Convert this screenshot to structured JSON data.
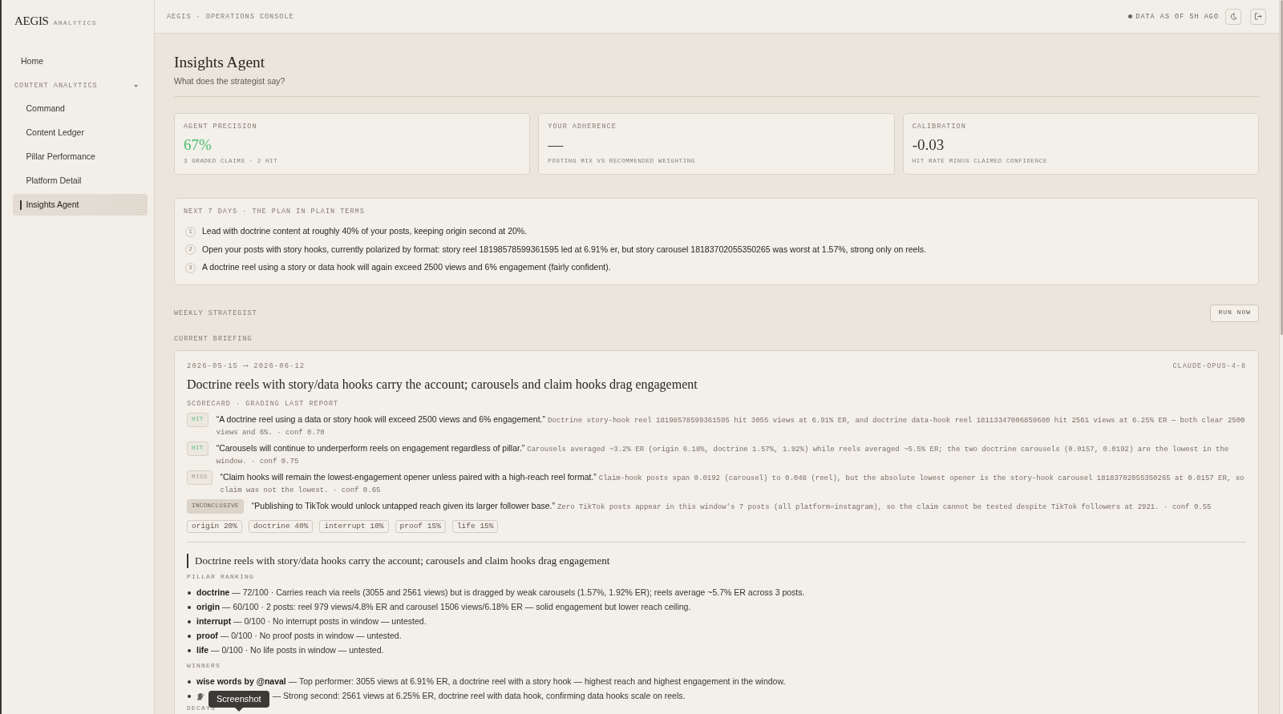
{
  "sidebar": {
    "brand": {
      "name": "AEGIS",
      "suffix": "ANALYTICS"
    },
    "items": [
      {
        "kind": "link",
        "label": "Home",
        "selected": false
      },
      {
        "kind": "section",
        "label": "CONTENT ANALYTICS",
        "expanded": true,
        "children": [
          {
            "label": "Command",
            "selected": false
          },
          {
            "label": "Content Ledger",
            "selected": false
          },
          {
            "label": "Pillar Performance",
            "selected": false
          },
          {
            "label": "Platform Detail",
            "selected": false
          },
          {
            "label": "Insights Agent",
            "selected": true
          }
        ]
      }
    ]
  },
  "topbar": {
    "breadcrumb": "AEGIS · OPERATIONS CONSOLE",
    "status": "DATA AS OF 5H AGO"
  },
  "page": {
    "title": "Insights Agent",
    "subtitle": "What does the strategist say?"
  },
  "kpis": [
    {
      "label": "AGENT PRECISION",
      "value": "67%",
      "note": "3 GRADED CLAIMS · 2 HIT",
      "color": "#45bf6b"
    },
    {
      "label": "YOUR ADHERENCE",
      "value": "—",
      "note": "POSTING MIX VS RECOMMENDED WEIGHTING",
      "color": "#3a342f"
    },
    {
      "label": "CALIBRATION",
      "value": "-0.03",
      "note": "HIT RATE MINUS CLAIMED CONFIDENCE",
      "color": "#3a342f"
    }
  ],
  "plan": {
    "heading": "NEXT 7 DAYS · THE PLAN IN PLAIN TERMS",
    "steps": [
      {
        "number": "1",
        "text": "Lead with doctrine content at roughly 40% of your posts, keeping origin second at 20%."
      },
      {
        "number": "2",
        "text": "Open your posts with story hooks, currently polarized by format: story reel 18198578599361595 led at 6.91% er, but story carousel 18183702055350265 was worst at 1.57%, strong only on reels."
      },
      {
        "number": "3",
        "text": "A doctrine reel using a story or data hook will again exceed 2500 views and 6% engagement (fairly confident)."
      }
    ]
  },
  "strategist": {
    "heading": "WEEKLY STRATEGIST",
    "run_button": "RUN NOW",
    "briefing_label": "CURRENT BRIEFING"
  },
  "briefing": {
    "range": "2026-05-15 ⟶ 2026-06-12",
    "model": "CLAUDE-OPUS-4-8",
    "title": "Doctrine reels with story/data hooks carry the account; carousels and claim hooks drag engagement",
    "scorecard_heading": "SCORECARD · GRADING LAST REPORT",
    "claims": [
      {
        "verdict": "HIT",
        "kind": "hit",
        "claim": "“A doctrine reel using a data or story hook will exceed 2500 views and 6% engagement.”",
        "evidence": "Doctrine story-hook reel 18198578599361595 hit 3055 views at 6.91% ER, and doctrine data-hook reel 18113347006859680 hit 2561 views at 6.25% ER — both clear 2500 views and 6%. · conf 0.70"
      },
      {
        "verdict": "HIT",
        "kind": "hit",
        "claim": "“Carousels will continue to underperform reels on engagement regardless of pillar.”",
        "evidence": "Carousels averaged ~3.2% ER (origin 6.18%, doctrine 1.57%, 1.92%) while reels averaged ~5.5% ER; the two doctrine carousels (0.0157, 0.0192) are the lowest in the window. · conf 0.75"
      },
      {
        "verdict": "MISS",
        "kind": "miss",
        "claim": "“Claim hooks will remain the lowest-engagement opener unless paired with a high-reach reel format.”",
        "evidence": "Claim-hook posts span 0.0192 (carousel) to 0.048 (reel), but the absolute lowest opener is the story-hook carousel 18183702055350265 at 0.0157 ER, so claim was not the lowest. · conf 0.65"
      },
      {
        "verdict": "INCONCLUSIVE",
        "kind": "inconclusive",
        "claim": "“Publishing to TikTok would unlock untapped reach given its larger follower base.”",
        "evidence": "Zero TikTok posts appear in this window's 7 posts (all platform=instagram), so the claim cannot be tested despite TikTok followers at 2921. · conf 0.55"
      }
    ],
    "weights": [
      "origin 20%",
      "doctrine 40%",
      "interrupt 10%",
      "proof 15%",
      "life 15%"
    ],
    "report": {
      "heading": "Doctrine reels with story/data hooks carry the account; carousels and claim hooks drag engagement",
      "sections": [
        {
          "heading": "PILLAR RANKING",
          "items": [
            {
              "text": "**doctrine** — 72/100 · Carries reach via reels (3055 and 2561 views) but is dragged by weak carousels (1.57%, 1.92% ER); reels average ~5.7% ER across 3 posts."
            },
            {
              "text": "**origin** — 60/100 · 2 posts: reel 979 views/4.8% ER and carousel 1506 views/6.18% ER — solid engagement but lower reach ceiling."
            },
            {
              "text": "**interrupt** — 0/100 · No interrupt posts in window — untested."
            },
            {
              "text": "**proof** — 0/100 · No proof posts in window — untested."
            },
            {
              "text": "**life** — 0/100 · No life posts in window — untested."
            }
          ]
        },
        {
          "heading": "WINNERS",
          "items": [
            {
              "text": "**wise words by @naval** — Top performer: 3055 views at 6.91% ER, a doctrine reel with a story hook — highest reach and highest engagement in the window.",
              "lead_icon": false
            },
            {
              "text": "— Strong second: 2561 views at 6.25% ER, doctrine reel with data hook, confirming data hooks scale on reels.",
              "lead_icon": true,
              "tooltip": "Screenshot"
            }
          ]
        },
        {
          "heading": "DECAYS"
        }
      ]
    }
  }
}
